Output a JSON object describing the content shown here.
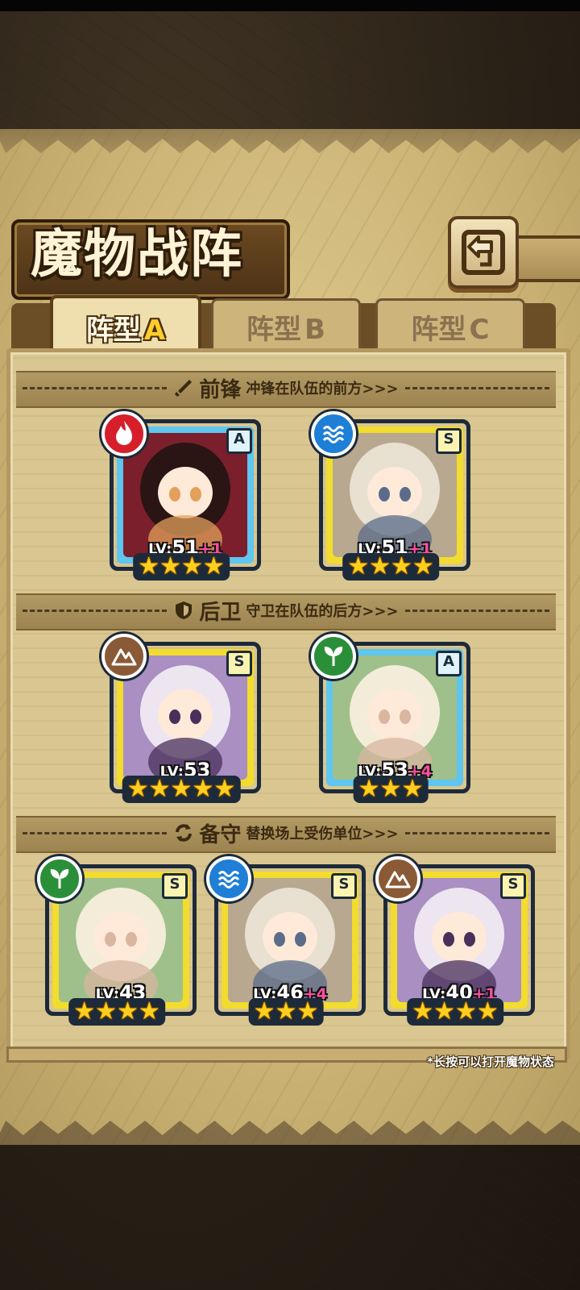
{
  "page": {
    "title": "魔物战阵",
    "hint": "*长按可以打开魔物状态"
  },
  "tabs": [
    {
      "prefix": "阵型",
      "letter": "A",
      "selected": true
    },
    {
      "prefix": "阵型",
      "letter": "B",
      "selected": false
    },
    {
      "prefix": "阵型",
      "letter": "C",
      "selected": false
    }
  ],
  "sections": {
    "front": {
      "title": "前锋",
      "desc": "冲锋在队伍的前方>>>",
      "icon": "sword-icon"
    },
    "rear": {
      "title": "后卫",
      "desc": "守卫在队伍的后方>>>",
      "icon": "shield-icon"
    },
    "reserve": {
      "title": "备守",
      "desc": "替换场上受伤单位>>>",
      "icon": "swap-icon"
    }
  },
  "monsters": {
    "front": [
      {
        "grade": "A",
        "element": "fire",
        "lv_word": "LV:",
        "level": "51",
        "bonus": "+1",
        "stars": 4,
        "frame": "blue"
      },
      {
        "grade": "S",
        "element": "water",
        "lv_word": "LV:",
        "level": "51",
        "bonus": "+1",
        "stars": 4,
        "frame": "yellow"
      }
    ],
    "rear": [
      {
        "grade": "S",
        "element": "earth",
        "lv_word": "LV:",
        "level": "53",
        "bonus": "",
        "stars": 5,
        "frame": "yellow"
      },
      {
        "grade": "A",
        "element": "wood",
        "lv_word": "LV:",
        "level": "53",
        "bonus": "+4",
        "stars": 3,
        "frame": "blue"
      }
    ],
    "reserve": [
      {
        "grade": "S",
        "element": "wood",
        "lv_word": "LV:",
        "level": "43",
        "bonus": "",
        "stars": 4,
        "frame": "yellow"
      },
      {
        "grade": "S",
        "element": "water",
        "lv_word": "LV:",
        "level": "46",
        "bonus": "+4",
        "stars": 3,
        "frame": "yellow"
      },
      {
        "grade": "S",
        "element": "earth",
        "lv_word": "LV:",
        "level": "40",
        "bonus": "+1",
        "stars": 4,
        "frame": "yellow"
      }
    ]
  },
  "colors": {
    "fire": "#d61f2b",
    "water": "#1f7fd6",
    "earth": "#8a5a36",
    "wood": "#2b8f3a",
    "frame_blue": "#5ec6ef",
    "frame_yellow": "#f2dc2e",
    "star": "#ffcf1f",
    "bonus": "#ff4fa0"
  }
}
